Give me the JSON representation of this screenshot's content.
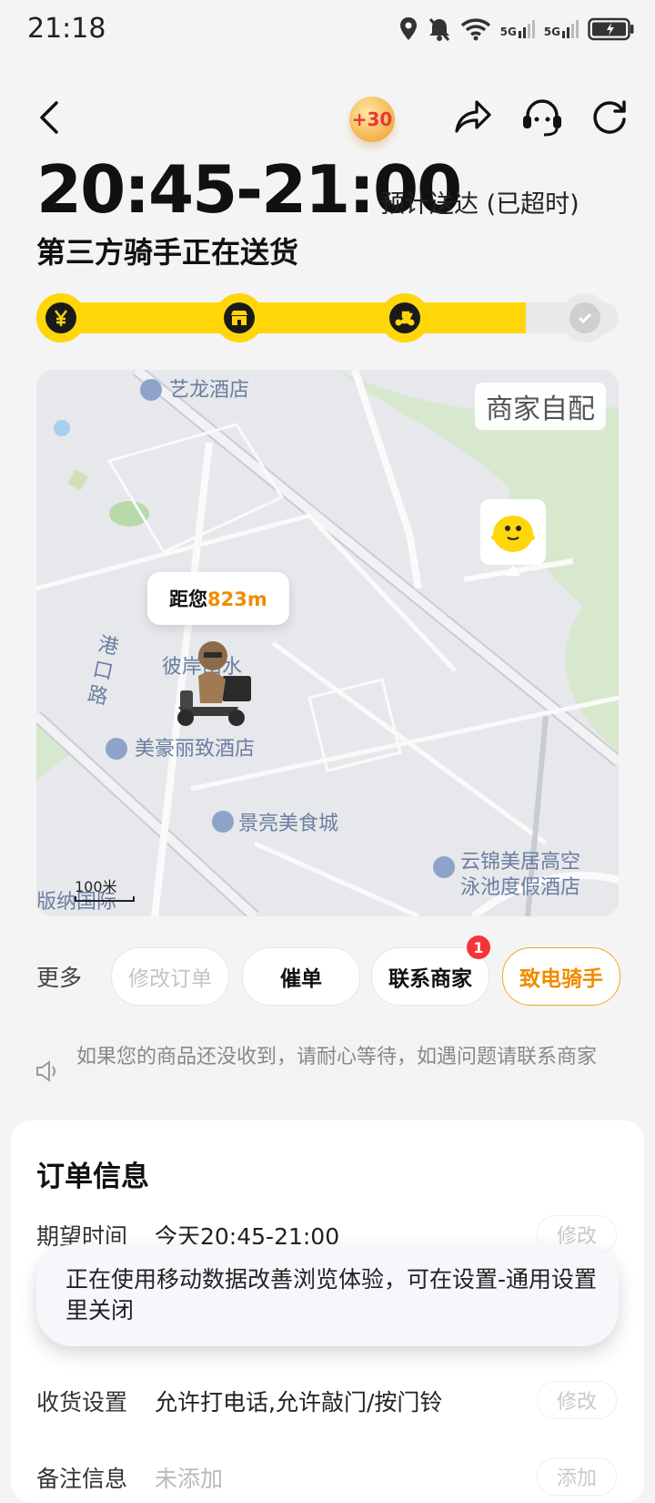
{
  "status_bar": {
    "time": "21:18",
    "signal1": "5G",
    "signal2": "5G"
  },
  "header": {
    "coin_label": "+30"
  },
  "eta": {
    "time_range": "20:45-21:00",
    "note": "预计送达 (已超时)"
  },
  "status_title": "第三方骑手正在送货",
  "progress": {
    "fraction": 0.84,
    "steps": [
      "paid",
      "store",
      "rider",
      "delivered"
    ]
  },
  "map": {
    "badge": "商家自配",
    "distance_prefix": "距您",
    "distance_value": "823m",
    "labels": {
      "hotel1": "艺龙酒店",
      "road": "港口路",
      "district": "彼岸山水",
      "hotel2": "美豪丽致酒店",
      "food": "景亮美食城",
      "resort_line1": "云锦美居高空",
      "resort_line2": "泳池度假酒店",
      "bottom_left": "版纳国际"
    },
    "scale": "100米"
  },
  "actions": {
    "more": "更多",
    "modify_order": "修改订单",
    "urge": "催单",
    "contact_merchant": "联系商家",
    "contact_badge": "1",
    "call_rider": "致电骑手"
  },
  "notice": "如果您的商品还没收到，请耐心等待，如遇问题请联系商家",
  "order_info": {
    "title": "订单信息",
    "expected_label": "期望时间",
    "expected_value": "今天20:45-21:00",
    "modify": "修改",
    "receive_label": "收货设置",
    "receive_value": "允许打电话,允许敲门/按门铃",
    "remark_label": "备注信息",
    "remark_value": "未添加",
    "add": "添加"
  },
  "toast": "正在使用移动数据改善浏览体验，可在设置-通用设置里关闭",
  "colors": {
    "accent": "#ffd60a",
    "orange": "#f08c00",
    "badge": "#f5343a"
  }
}
